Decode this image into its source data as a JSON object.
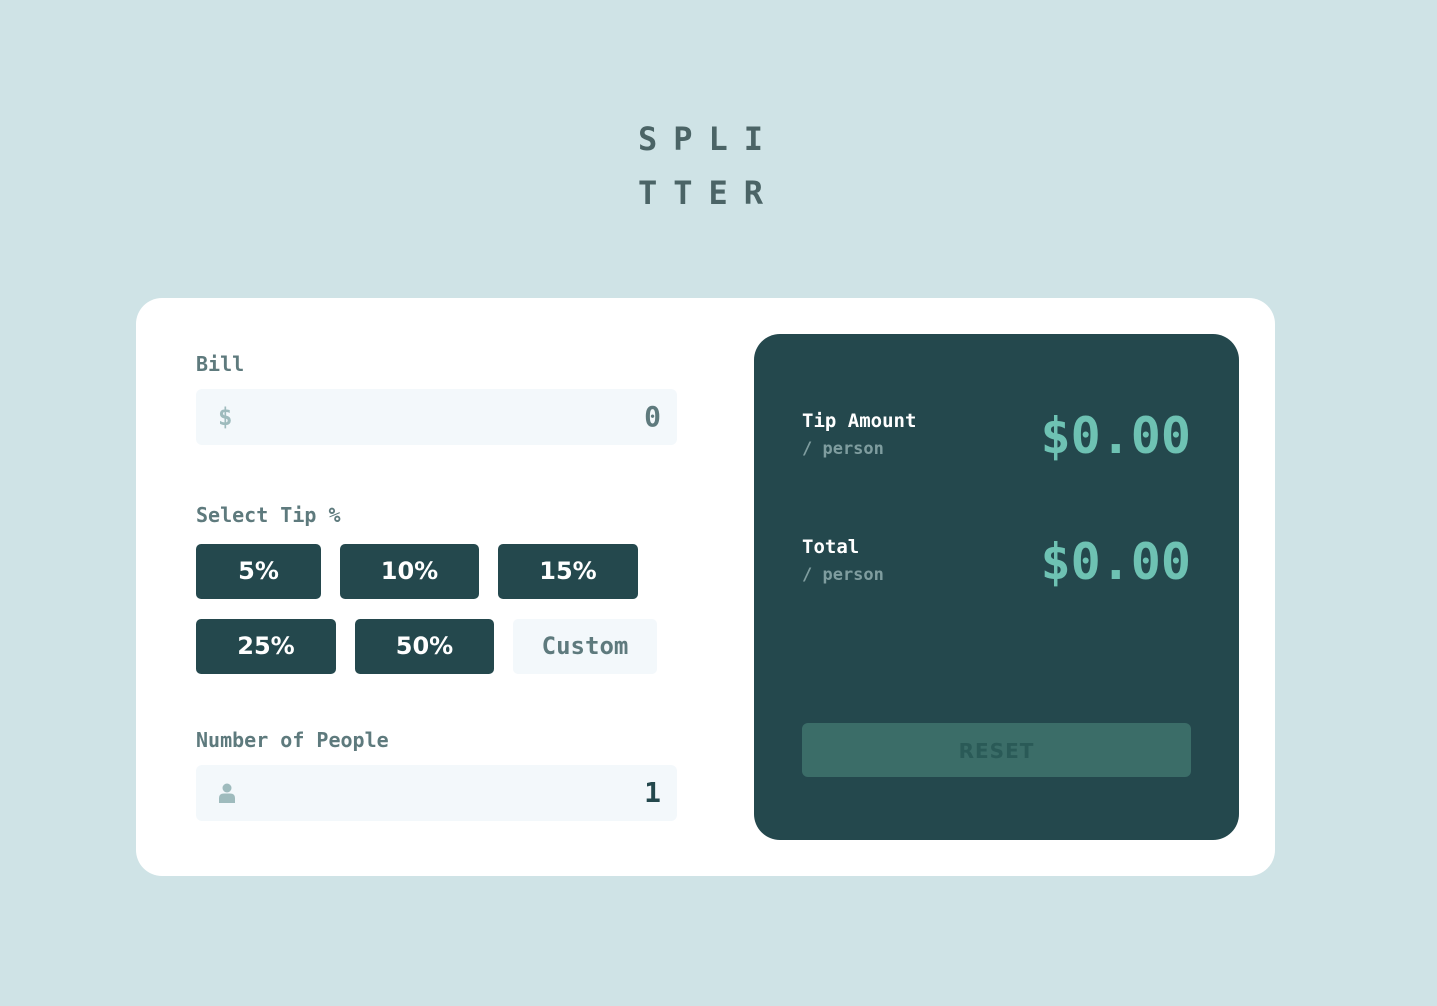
{
  "logo": {
    "line1": "SPLI",
    "line2": "TTER"
  },
  "bill": {
    "label": "Bill",
    "prefix": "$",
    "value": "0"
  },
  "tip": {
    "label": "Select Tip %",
    "options": [
      "5%",
      "10%",
      "15%",
      "25%",
      "50%"
    ],
    "custom_placeholder": "Custom"
  },
  "people": {
    "label": "Number of People",
    "icon": "person-icon",
    "value": "1"
  },
  "results": {
    "tip_amount": {
      "label": "Tip Amount",
      "sublabel": "/ person",
      "value": "$0.00"
    },
    "total": {
      "label": "Total",
      "sublabel": "/ person",
      "value": "$0.00"
    },
    "reset_label": "RESET"
  },
  "colors": {
    "background": "#cfe3e6",
    "dark_green": "#24484d",
    "accent": "#6ec2b3",
    "input_bg": "#f3f8fb"
  }
}
